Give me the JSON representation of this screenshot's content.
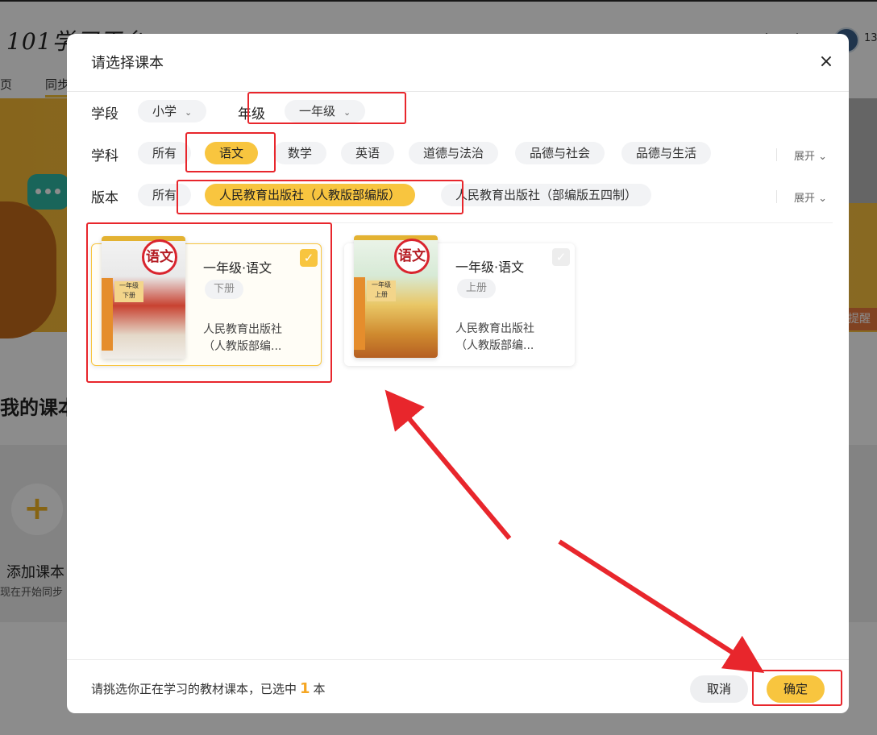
{
  "background": {
    "logo": "101学习平台",
    "nav": [
      "页",
      "同步"
    ],
    "top_icons": [
      "火",
      "订"
    ],
    "user": "13",
    "remind": "提醒",
    "section_title": "我的课本",
    "add_title": "添加课本",
    "add_sub": "现在开始同步"
  },
  "dialog": {
    "title": "请选择课本",
    "close_icon": "×",
    "stage": {
      "label": "学段",
      "value": "小学"
    },
    "grade": {
      "label": "年级",
      "value": "一年级"
    },
    "subject": {
      "label": "学科",
      "options": [
        "所有",
        "语文",
        "数学",
        "英语",
        "道德与法治",
        "品德与社会",
        "品德与生活"
      ],
      "selected": "语文",
      "expand": "展开"
    },
    "edition": {
      "label": "版本",
      "options": [
        "所有",
        "人民教育出版社（人教版部编版）",
        "人民教育出版社（部编版五四制）"
      ],
      "selected": "人民教育出版社（人教版部编版）",
      "expand": "展开"
    },
    "books": [
      {
        "name": "一年级·语文",
        "volume": "下册",
        "publisher_line1": "人民教育出版社",
        "publisher_line2": "（人教版部编...",
        "cover_title": "语文",
        "cover_grade_1": "一年级",
        "cover_grade_2": "下册",
        "selected": true
      },
      {
        "name": "一年级·语文",
        "volume": "上册",
        "publisher_line1": "人民教育出版社",
        "publisher_line2": "（人教版部编...",
        "cover_title": "语文",
        "cover_grade_1": "一年级",
        "cover_grade_2": "上册",
        "selected": false
      }
    ],
    "footer": {
      "text_before": "请挑选你正在学习的教材课本，已选中",
      "count": "1",
      "text_after": "本",
      "cancel": "取消",
      "confirm": "确定"
    }
  },
  "colors": {
    "accent": "#f8c53f",
    "annotation": "#e8262c",
    "count": "#f5a623"
  }
}
